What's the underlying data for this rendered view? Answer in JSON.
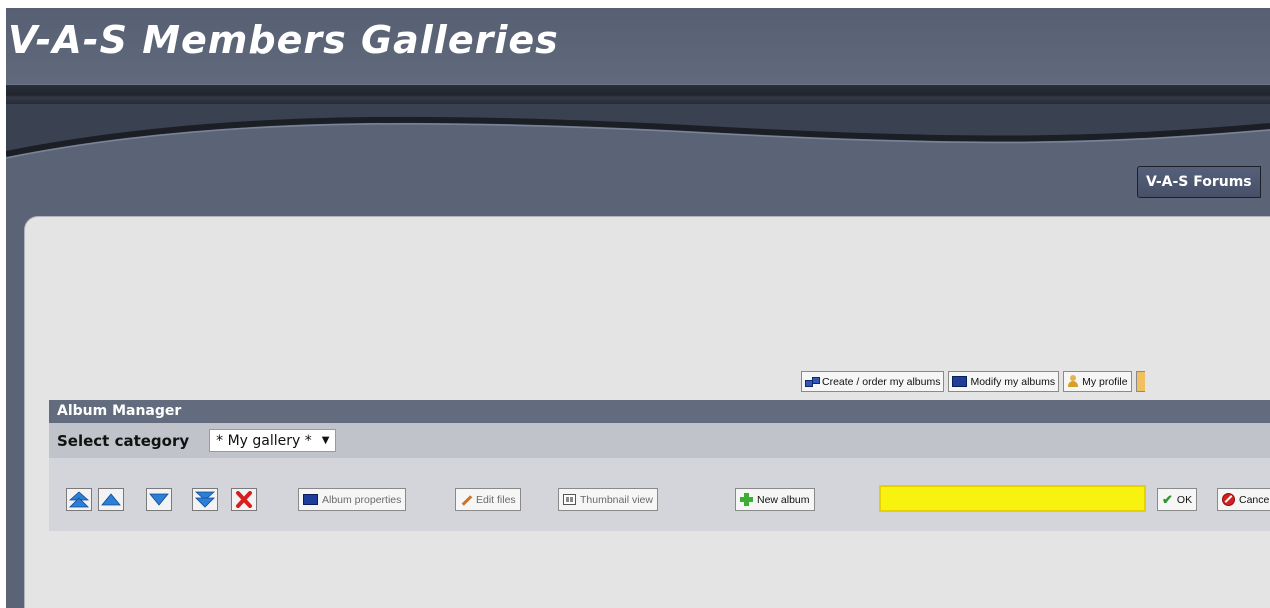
{
  "site": {
    "title": "V-A-S Members Galleries",
    "forums_button": "V-A-S Forums"
  },
  "top_links": [
    {
      "label": "Create / order my albums",
      "icon": "albums-network-icon"
    },
    {
      "label": "Modify my albums",
      "icon": "monitor-icon"
    },
    {
      "label": "My profile",
      "icon": "user-icon"
    }
  ],
  "album_manager": {
    "title": "Album Manager",
    "select_category_label": "Select category",
    "selected_category": "* My gallery *",
    "reorder_buttons": [
      {
        "name": "move-to-top-button",
        "icon": "double-up-arrow-icon"
      },
      {
        "name": "move-up-button",
        "icon": "up-arrow-icon"
      },
      {
        "name": "move-down-button",
        "icon": "down-arrow-icon"
      },
      {
        "name": "move-to-bottom-button",
        "icon": "double-down-arrow-icon"
      },
      {
        "name": "delete-album-button",
        "icon": "red-x-icon"
      }
    ],
    "album_properties_label": "Album properties",
    "edit_files_label": "Edit files",
    "thumbnail_view_label": "Thumbnail view",
    "new_album_label": "New album",
    "new_album_input_value": "",
    "ok_label": "OK",
    "cancel_label": "Cance"
  },
  "colors": {
    "header_bg": "#5a6476",
    "content_bg": "#e4e4e4",
    "album_manager_header": "#626c7e",
    "category_row": "#c0c3c9",
    "toolbar_row": "#d3d5da",
    "input_highlight": "#f7f30f",
    "arrow_blue": "#2d7fd6"
  }
}
